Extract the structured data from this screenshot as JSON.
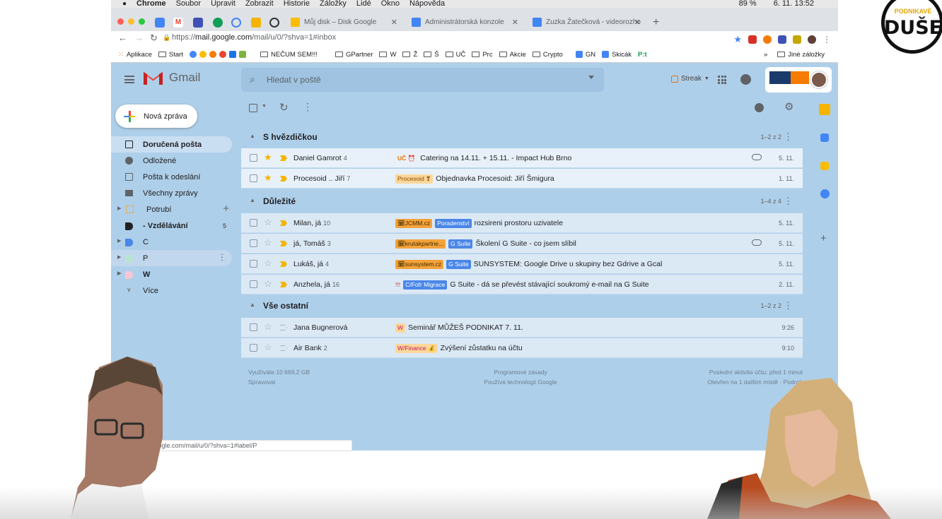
{
  "mac_menu": {
    "app": "Chrome",
    "items": [
      "Soubor",
      "Upravit",
      "Zobrazit",
      "Historie",
      "Záložky",
      "Lidé",
      "Okno",
      "Nápověda"
    ],
    "clock": "6. 11.  13:52",
    "battery": "89 %"
  },
  "browser": {
    "tabs": [
      {
        "label": "Můj disk – Disk Google",
        "color": "#fbbc04"
      },
      {
        "label": "Administrátorská konzole",
        "color": "#4285f4"
      },
      {
        "label": "Zuzka Žatečková - videorozho",
        "color": "#4285f4"
      }
    ],
    "url_prefix": "https://",
    "url_host": "mail.google.com",
    "url_path": "/mail/u/0/?shva=1#inbox",
    "bookmarks": [
      "Aplikace",
      "Start",
      "NEČUM SEM!!!",
      "GPartner",
      "W",
      "Ž",
      "Š",
      "UČ",
      "Prc",
      "Akcie",
      "Crypto",
      "GN",
      "Skicák",
      "P:t"
    ],
    "more": "»",
    "other_bookmarks": "Jiné záložky"
  },
  "gmail": {
    "logo": "Gmail",
    "search_placeholder": "Hledat v poště",
    "streak": "Streak",
    "compose": "Nová zpráva",
    "nav": [
      {
        "label": "Doručená pošta",
        "icon": "inbox-icon"
      },
      {
        "label": "Odložené",
        "icon": "clock-icon"
      },
      {
        "label": "Pošta k odeslání",
        "icon": "outbox-icon"
      },
      {
        "label": "Všechny zprávy",
        "icon": "mail-icon"
      },
      {
        "label": "Potrubí",
        "icon": "pipeline-icon"
      },
      {
        "label": "- Vzdělávání",
        "count": "5",
        "color": "#202124"
      },
      {
        "label": "C",
        "color": "#4a86e8"
      },
      {
        "label": "P",
        "color": "#b9e4d0"
      },
      {
        "label": "W",
        "color": "#f7c6d5"
      },
      {
        "label": "Více"
      }
    ],
    "sections": [
      {
        "title": "S hvězdičkou",
        "range": "1–2 z 2"
      },
      {
        "title": "Důležité",
        "range": "1–4 z 4"
      },
      {
        "title": "Vše ostatní",
        "range": "1–2 z 2"
      }
    ],
    "rows": [
      {
        "from": "Daniel Gamrot",
        "count": "4",
        "chips": [
          {
            "text": "UČ ⏰",
            "style": "pale"
          }
        ],
        "subject": "Catering na 14.11. + 15.11. - Impact Hub Brno",
        "date": "5. 11.",
        "starred": true,
        "important": true,
        "attachment": true
      },
      {
        "from": "Procesoid .. Jiří",
        "count": "7",
        "chips": [
          {
            "text": "Procesoid ❣",
            "style": "pale"
          }
        ],
        "subject": "Objednavka Procesoid: Jiří Šmigura",
        "date": "1. 11.",
        "starred": true,
        "important": true,
        "attachment": false
      },
      {
        "from": "Milan, já",
        "count": "10",
        "chips": [
          {
            "text": "🗓JCMM.cz",
            "style": "orange"
          },
          {
            "text": "Poradenství",
            "style": "blue"
          }
        ],
        "subject": "rozsireni prostoru uzivatele",
        "date": "5. 11.",
        "starred": false,
        "important": true,
        "attachment": false
      },
      {
        "from": "já, Tomáš",
        "count": "3",
        "chips": [
          {
            "text": "🗓krutakpartne...",
            "style": "orange"
          },
          {
            "text": "G Suite",
            "style": "blue"
          }
        ],
        "subject": "Školení G Suite - co jsem slíbil",
        "date": "5. 11.",
        "starred": false,
        "important": true,
        "attachment": true
      },
      {
        "from": "Lukáš, já",
        "count": "4",
        "chips": [
          {
            "text": "🗓sunsystem.cz",
            "style": "orange"
          },
          {
            "text": "G Suite",
            "style": "blue"
          }
        ],
        "subject": "SUNSYSTEM: Google Drive u skupiny bez Gdrive a Gcal",
        "date": "5. 11.",
        "starred": false,
        "important": true,
        "attachment": false
      },
      {
        "from": "Anzhela, já",
        "count": "16",
        "chips": [
          {
            "text": "!!!",
            "style": "red"
          },
          {
            "text": "C/Fofr Migrace",
            "style": "blue"
          }
        ],
        "subject": "G Suite - dá se převést stávající soukromý e-mail na G Suite",
        "date": "2. 11.",
        "starred": false,
        "important": true,
        "attachment": false
      },
      {
        "from": "Jana Bugnerová",
        "count": "",
        "chips": [
          {
            "text": "W",
            "style": "pale"
          }
        ],
        "subject": "Seminář MŮŽEŠ PODNIKAT 7. 11.",
        "date": "9:26",
        "starred": false,
        "important": false,
        "attachment": false
      },
      {
        "from": "Air Bank",
        "count": "2",
        "chips": [
          {
            "text": "W/Finance 💰",
            "style": "pale"
          }
        ],
        "subject": "Zvýšení zůstatku na účtu",
        "date": "9:10",
        "starred": false,
        "important": false,
        "attachment": false
      }
    ],
    "footer": {
      "storage": "Využíváte 10 669,2 GB",
      "manage": "Spravovat",
      "policy": "Programové zásady",
      "powered": "Používá technologii Google",
      "activity": "Poslední aktivita účtu: před 1 minut",
      "open_elsewhere": "Otevřen na 1 dalším místě · Podrob"
    }
  },
  "status_url": "...oogle.com/mail/u/0/?shva=1#label/P",
  "badge": {
    "line1": "PODNIKAVÉ",
    "line2": "DUŠE"
  },
  "colors": {
    "gmail_bg": "#aecfe9",
    "star": "#f4b400",
    "brand_red": "#ea4335"
  }
}
